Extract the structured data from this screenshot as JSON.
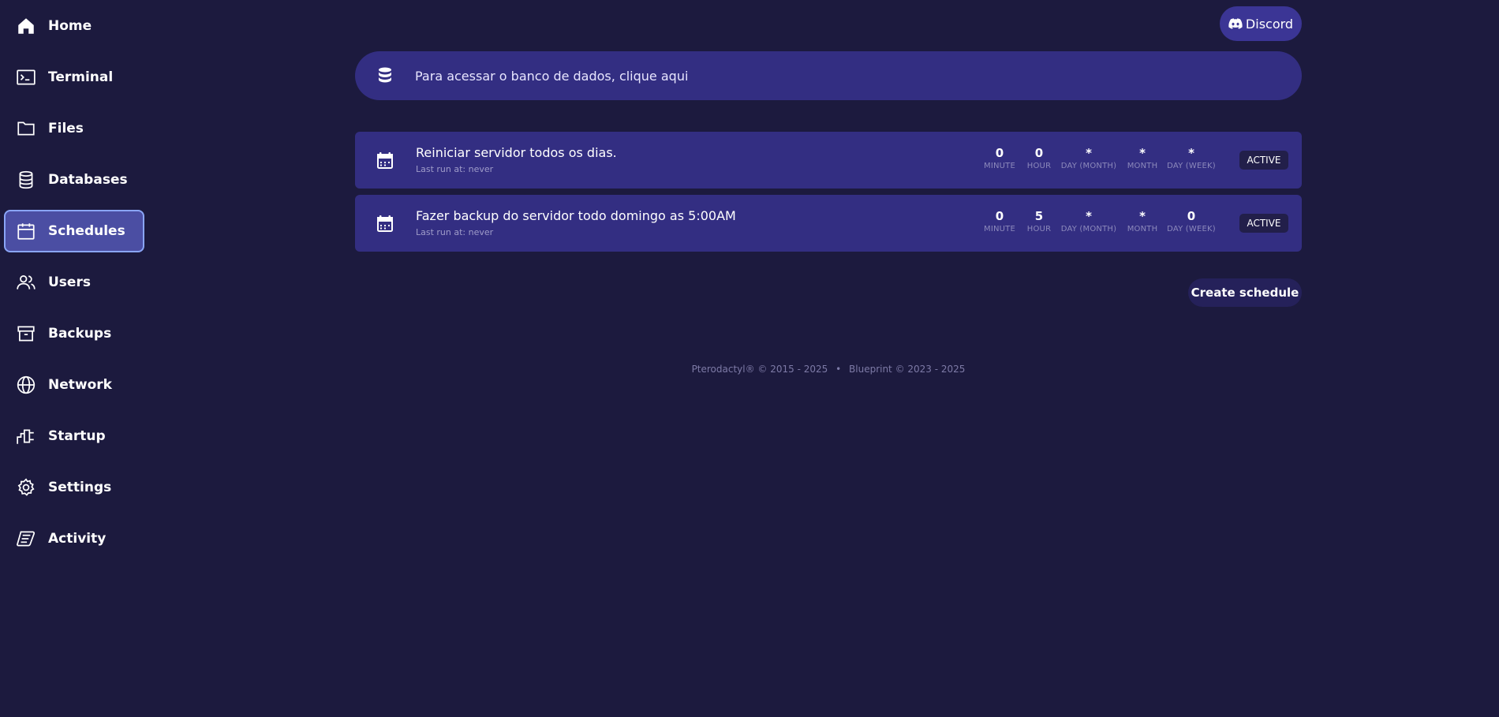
{
  "sidebar": {
    "items": [
      {
        "label": "Home",
        "icon": "home-icon"
      },
      {
        "label": "Terminal",
        "icon": "terminal-icon"
      },
      {
        "label": "Files",
        "icon": "folder-icon"
      },
      {
        "label": "Databases",
        "icon": "database-icon"
      },
      {
        "label": "Schedules",
        "icon": "calendar-icon",
        "active": true
      },
      {
        "label": "Users",
        "icon": "users-icon"
      },
      {
        "label": "Backups",
        "icon": "archive-icon"
      },
      {
        "label": "Network",
        "icon": "globe-icon"
      },
      {
        "label": "Startup",
        "icon": "plug-icon"
      },
      {
        "label": "Settings",
        "icon": "gear-icon"
      },
      {
        "label": "Activity",
        "icon": "scroll-icon"
      }
    ]
  },
  "header": {
    "discord_label": "Discord"
  },
  "banner": {
    "text": "Para acessar o banco de dados, clique aqui"
  },
  "cron_labels": {
    "minute": "MINUTE",
    "hour": "HOUR",
    "day_month": "DAY (MONTH)",
    "month": "MONTH",
    "day_week": "DAY (WEEK)"
  },
  "schedules": [
    {
      "name": "Reiniciar servidor todos os dias.",
      "last_run": "Last run at: never",
      "minute": "0",
      "hour": "0",
      "day_month": "*",
      "month": "*",
      "day_week": "*",
      "status": "ACTIVE"
    },
    {
      "name": "Fazer backup do servidor todo domingo as 5:00AM",
      "last_run": "Last run at: never",
      "minute": "0",
      "hour": "5",
      "day_month": "*",
      "month": "*",
      "day_week": "0",
      "status": "ACTIVE"
    }
  ],
  "actions": {
    "create_label": "Create schedule"
  },
  "footer": {
    "pterodactyl": "Pterodactyl® © 2015 - 2025",
    "separator": "•",
    "blueprint": "Blueprint © 2023 - 2025"
  },
  "colors": {
    "background": "#1c1a3e",
    "card": "#332e82",
    "active_nav": "#4b4ea3",
    "active_border": "#8aa5f7"
  }
}
